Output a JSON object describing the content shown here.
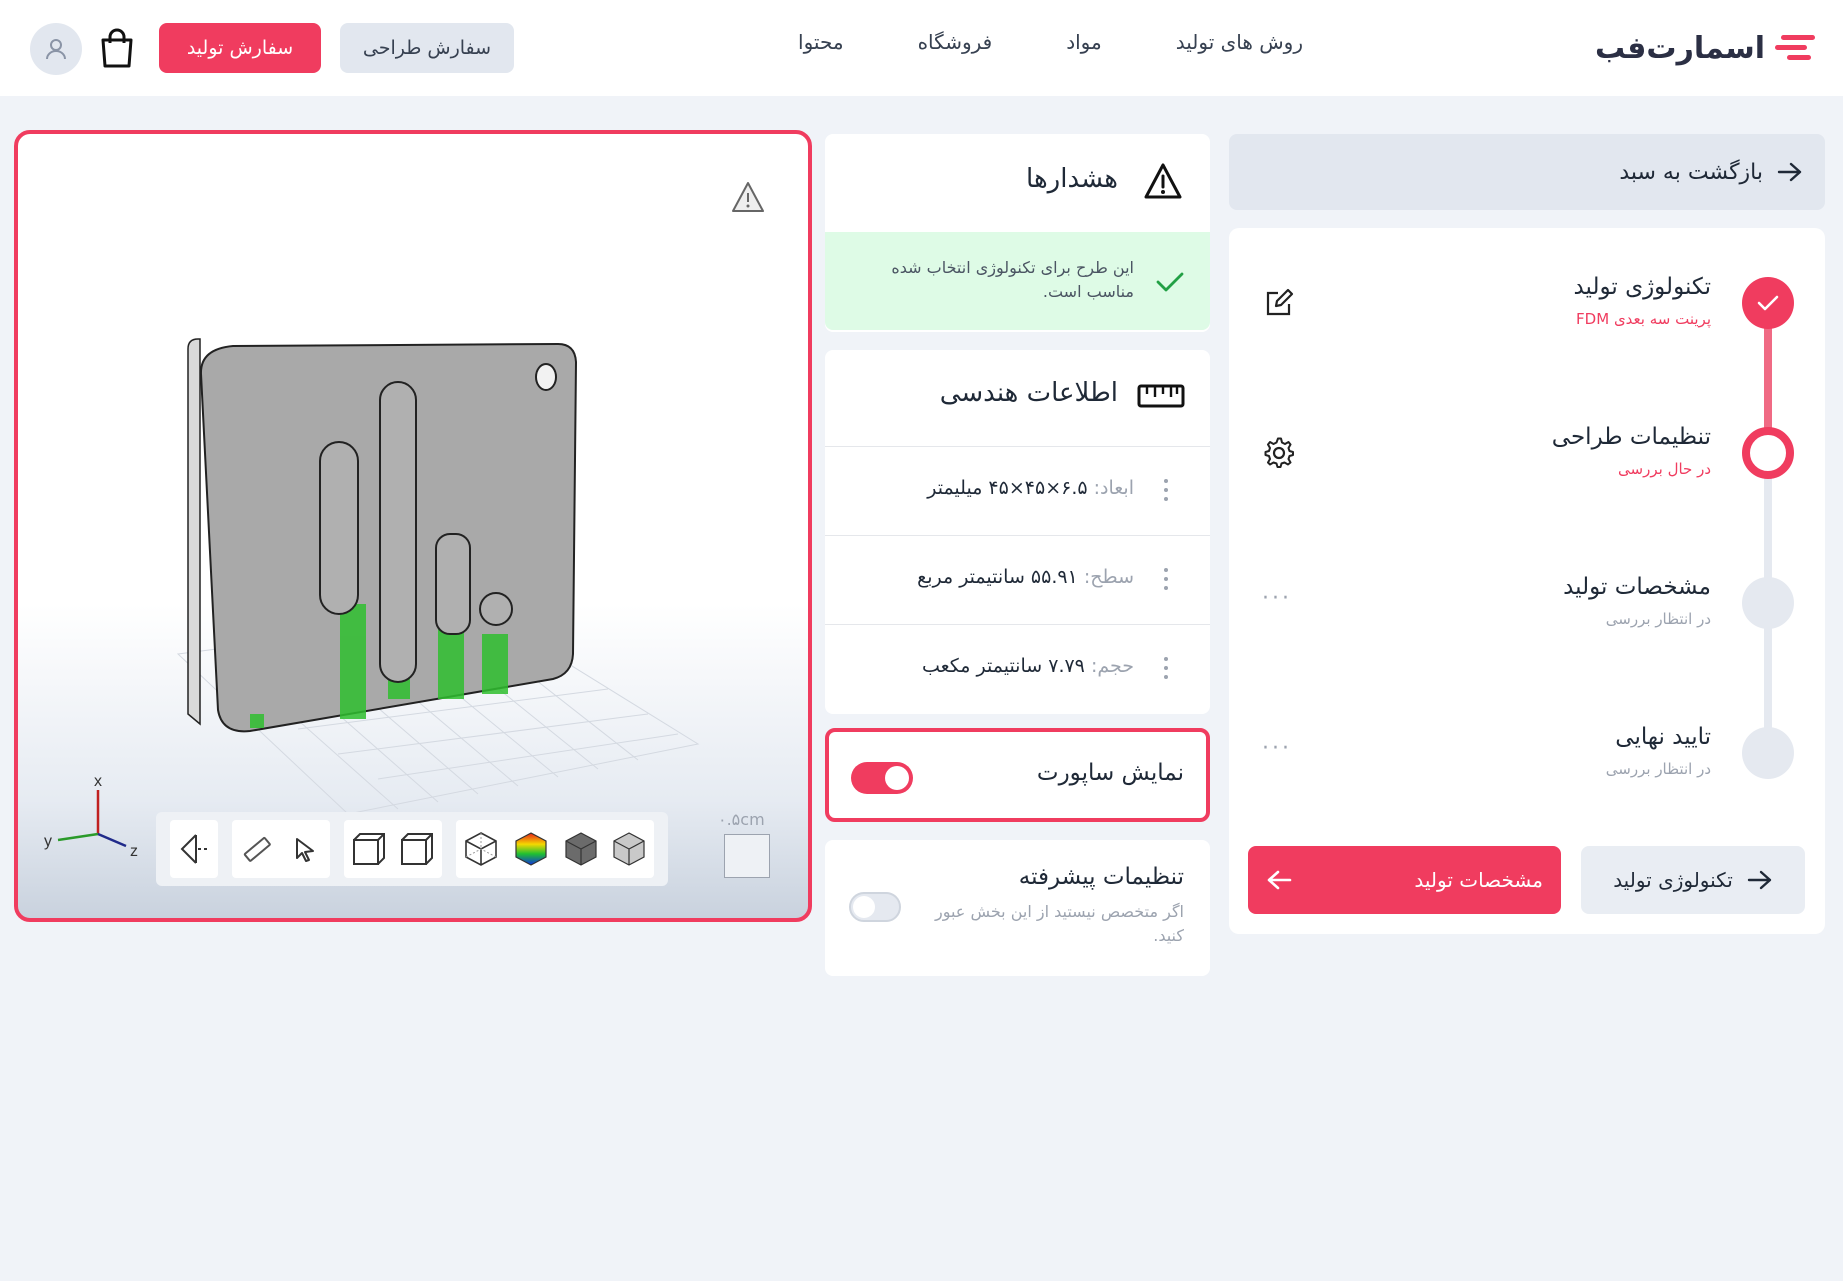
{
  "header": {
    "logo_text": "اسمارت‌فب",
    "nav": [
      "روش های تولید",
      "مواد",
      "فروشگاه",
      "محتوا"
    ],
    "btn_design_order": "سفارش طراحی",
    "btn_production_order": "سفارش تولید",
    "icons": [
      "cart-icon",
      "user-icon"
    ]
  },
  "sidebar": {
    "back_label": "بازگشت به سبد",
    "steps": [
      {
        "title": "تکنولوژی تولید",
        "subtitle": "پرینت سه بعدی FDM",
        "state": "done"
      },
      {
        "title": "تنظیمات طراحی",
        "subtitle": "در حال بررسی",
        "state": "active"
      },
      {
        "title": "مشخصات تولید",
        "subtitle": "در انتظار بررسی",
        "state": "pending"
      },
      {
        "title": "تایید نهایی",
        "subtitle": "در انتظار بررسی",
        "state": "pending"
      }
    ],
    "btn_next": "مشخصات تولید",
    "btn_prev": "تکنولوژی تولید"
  },
  "warnings": {
    "title": "هشدارها",
    "ok_message": "این طرح برای تکنولوژی انتخاب شده مناسب است."
  },
  "geometry": {
    "title": "اطلاعات هندسی",
    "rows": [
      {
        "label": "ابعاد:",
        "value": "۶.۵×۴۵×۴۵ میلیمتر"
      },
      {
        "label": "سطح:",
        "value": "۵۵.۹۱ سانتیمتر مربع"
      },
      {
        "label": "حجم:",
        "value": "۷.۷۹ سانتیمتر مکعب"
      }
    ]
  },
  "support": {
    "label": "نمایش ساپورت",
    "enabled": true
  },
  "advanced": {
    "title": "تنظیمات پیشرفته",
    "description": "اگر متخصص نیستید از این بخش عبور کنید.",
    "enabled": false
  },
  "viewer": {
    "scale_label": "۰.۵cm",
    "axes": [
      "x",
      "y",
      "z"
    ]
  },
  "colors": {
    "accent": "#f03c5f",
    "success_bg": "#defbe6",
    "support_green": "#2fbf2f"
  }
}
